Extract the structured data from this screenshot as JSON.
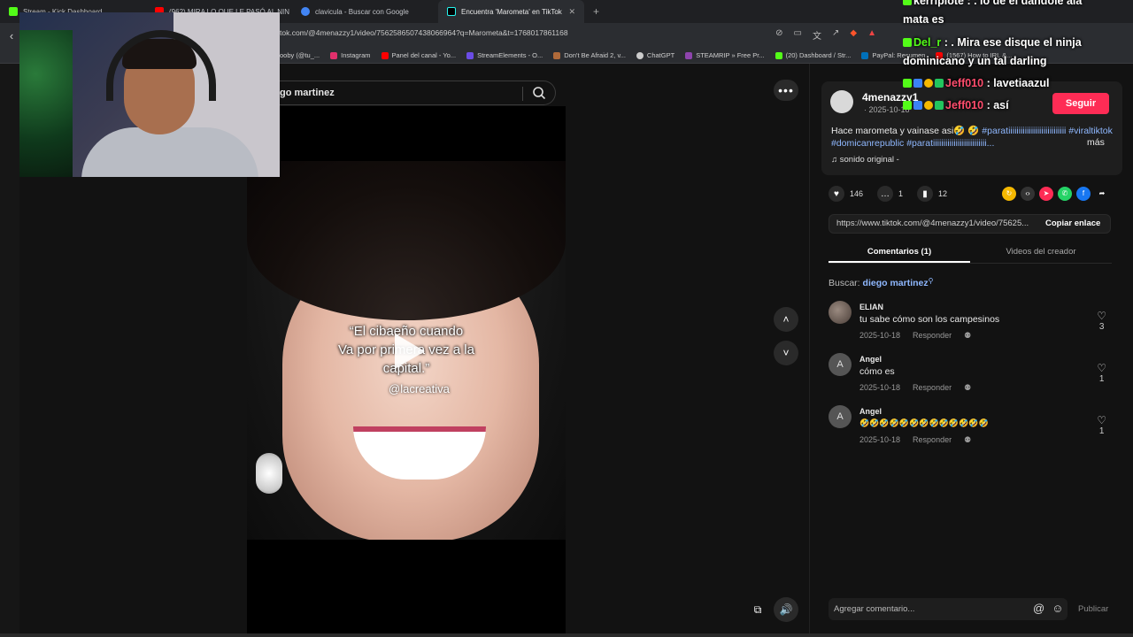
{
  "browser": {
    "tabs": [
      {
        "title": "Stream - Kick Dashboard",
        "icon": "kick-icon",
        "color": "#53fc18"
      },
      {
        "title": "(962) MIRA LO QUE LE PASÓ AL NIN",
        "icon": "youtube-icon",
        "color": "#ff0000"
      },
      {
        "title": "clavicula - Buscar con Google",
        "icon": "google-icon",
        "color": "#4285f4"
      },
      {
        "title": "Encuentra 'Marometa' en TikTok",
        "icon": "tiktok-icon",
        "color": "#111111"
      }
    ],
    "url": "tok.com/@4menazzy1/video/7562586507438066964?q=Marometa&t=1768017861168",
    "bookmarks": [
      {
        "label": "ooby (@tu_...",
        "color": "#888888"
      },
      {
        "label": "Instagram",
        "color": "#e1306c"
      },
      {
        "label": "Panel del canal - Yo...",
        "color": "#ff0000"
      },
      {
        "label": "StreamElements - O...",
        "color": "#6b4ce6"
      },
      {
        "label": "Don't Be Afraid 2, v...",
        "color": "#b06a3a"
      },
      {
        "label": "ChatGPT",
        "color": "#cccccc"
      },
      {
        "label": "STEAMRIP » Free Pr...",
        "color": "#8e44ad"
      },
      {
        "label": "(20) Dashboard / Str...",
        "color": "#53fc18"
      },
      {
        "label": "PayPal: Resumen",
        "color": "#0070ba"
      },
      {
        "label": "(1567) How to IRL &...",
        "color": "#ff0000"
      }
    ]
  },
  "search": {
    "query": "go martinez"
  },
  "video": {
    "caption_lines": [
      "“El cibaeño cuando",
      "Va por primera vez a la",
      "capital.”"
    ],
    "tag": "@lacreativa"
  },
  "author": {
    "name": "4menazzy1",
    "date": "· 2025-10-18",
    "follow_label": "Seguir",
    "description_plain": "Hace marometa y vainase asi🤣 🤣",
    "description_tags": "#paratiiiiiiiiiiiiiiiiiiiiiiiiiiii #viraltiktok #domicanrepublic #paratiiiiiiiiiiiiiiiiiiiiiiiiii...",
    "more_label": "más",
    "sound": "♫  sonido original -"
  },
  "stats": {
    "likes": "146",
    "comments": "1",
    "saves": "12"
  },
  "link": {
    "url": "https://www.tiktok.com/@4menazzy1/video/75625...",
    "copy_label": "Copiar enlace"
  },
  "tabs": {
    "comments": "Comentarios (1)",
    "creator_videos": "Videos del creador"
  },
  "search_label": {
    "prefix": "Buscar:",
    "query": "diego martinez"
  },
  "comments": [
    {
      "user": "ELIAN",
      "text": "tu sabe cómo son los campesinos",
      "date": "2025-10-18",
      "reply": "Responder",
      "likes": "3",
      "avatar": ""
    },
    {
      "user": "Angel",
      "text": "cómo es",
      "date": "2025-10-18",
      "reply": "Responder",
      "likes": "1",
      "avatar": "A"
    },
    {
      "user": "Angel",
      "text": "🤣🤣🤣🤣🤣🤣🤣🤣🤣🤣🤣🤣🤣",
      "date": "2025-10-18",
      "reply": "Responder",
      "likes": "1",
      "avatar": "A"
    }
  ],
  "comment_input": {
    "placeholder": "Agregar comentario...",
    "publish": "Publicar"
  },
  "stream_chat": [
    {
      "user": "kerriplote",
      "msg": ": . lo de el dandole ala",
      "color": "#ffffff"
    },
    {
      "user": "",
      "msg": "mata es",
      "color": "#ffffff"
    },
    {
      "user": "Del_r",
      "msg": ": . Mira ese disque el ninja",
      "color": "#53fc18"
    },
    {
      "user": "",
      "msg": "dominicano y un tal darling",
      "color": "#ffffff"
    },
    {
      "user": "Jeff010",
      "msg": ": lavetiaazul",
      "color": "#ff4d6d"
    },
    {
      "user": "Jeff010",
      "msg": ": así",
      "color": "#ff4d6d"
    }
  ]
}
